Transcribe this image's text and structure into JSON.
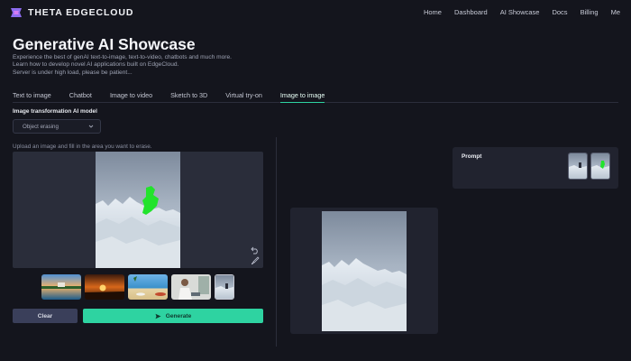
{
  "brand": {
    "name": "THETA EDGECLOUD"
  },
  "nav": [
    "Home",
    "Dashboard",
    "AI Showcase",
    "Docs",
    "Billing",
    "Me"
  ],
  "page": {
    "title": "Generative AI Showcase",
    "description": [
      "Experience the best of genAI text-to-image, text-to-video, chatbots and much more.",
      "Learn how to develop novel AI applications built on EdgeCloud.",
      "Server is under high load, please be patient..."
    ]
  },
  "tabs": [
    "Text to image",
    "Chatbot",
    "Image to video",
    "Sketch to 3D",
    "Virtual try-on",
    "Image to image"
  ],
  "active_tab": "Image to image",
  "model": {
    "label": "Image transformation AI model",
    "selected": "Object erasing"
  },
  "upload_hint": "Upload an image and fill in the area you want to erase.",
  "buttons": {
    "clear": "Clear",
    "generate": "Generate"
  },
  "prompt": {
    "label": "Prompt"
  },
  "colors": {
    "accent": "#2ed3a1",
    "background": "#14151d",
    "panel": "#21232f",
    "mask": "#22e32c"
  },
  "icons": [
    "theta-logo-icon",
    "chevron-down-icon",
    "undo-icon",
    "brush-icon",
    "send-icon"
  ]
}
